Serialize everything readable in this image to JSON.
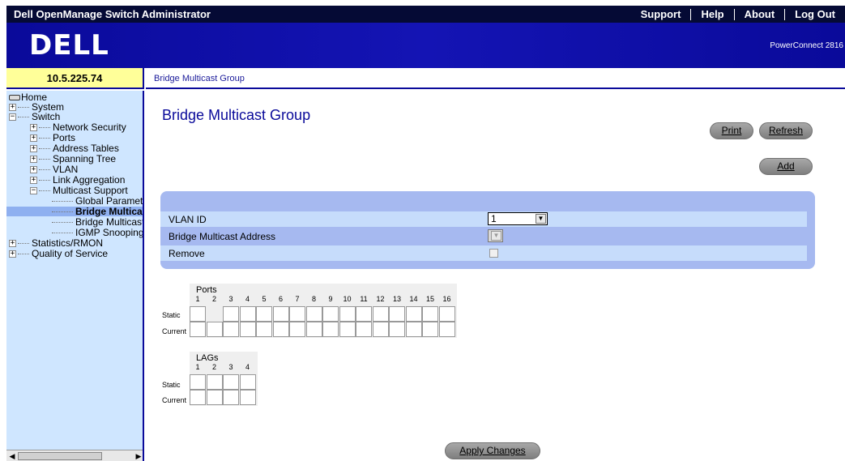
{
  "topbar": {
    "title": "Dell OpenManage Switch Administrator",
    "links": [
      "Support",
      "Help",
      "About",
      "Log Out"
    ]
  },
  "header": {
    "logo": "DELL",
    "product": "PowerConnect 2816"
  },
  "ip_address": "10.5.225.74",
  "breadcrumb": "Bridge Multicast Group",
  "sidebar": {
    "items": [
      {
        "label": "Home"
      },
      {
        "label": "System"
      },
      {
        "label": "Switch"
      },
      {
        "label": "Network Security"
      },
      {
        "label": "Ports"
      },
      {
        "label": "Address Tables"
      },
      {
        "label": "Spanning Tree"
      },
      {
        "label": "VLAN"
      },
      {
        "label": "Link Aggregation"
      },
      {
        "label": "Multicast Support"
      },
      {
        "label": "Global Parameters"
      },
      {
        "label": "Bridge Multicast Group"
      },
      {
        "label": "Bridge Multicast Forward All"
      },
      {
        "label": "IGMP Snooping"
      },
      {
        "label": "Statistics/RMON"
      },
      {
        "label": "Quality of Service"
      }
    ]
  },
  "main": {
    "title": "Bridge Multicast Group",
    "buttons": {
      "print": "Print",
      "refresh": "Refresh",
      "add": "Add",
      "apply": "Apply Changes"
    },
    "form": {
      "vlan_id_label": "VLAN ID",
      "vlan_id_value": "1",
      "mcast_address_label": "Bridge Multicast Address",
      "remove_label": "Remove"
    },
    "ports_table": {
      "title": "Ports",
      "numbers": [
        "1",
        "2",
        "3",
        "4",
        "5",
        "6",
        "7",
        "8",
        "9",
        "10",
        "11",
        "12",
        "13",
        "14",
        "15",
        "16"
      ],
      "static_label": "Static",
      "current_label": "Current"
    },
    "lags_table": {
      "title": "LAGs",
      "numbers": [
        "1",
        "2",
        "3",
        "4"
      ],
      "static_label": "Static",
      "current_label": "Current"
    }
  }
}
